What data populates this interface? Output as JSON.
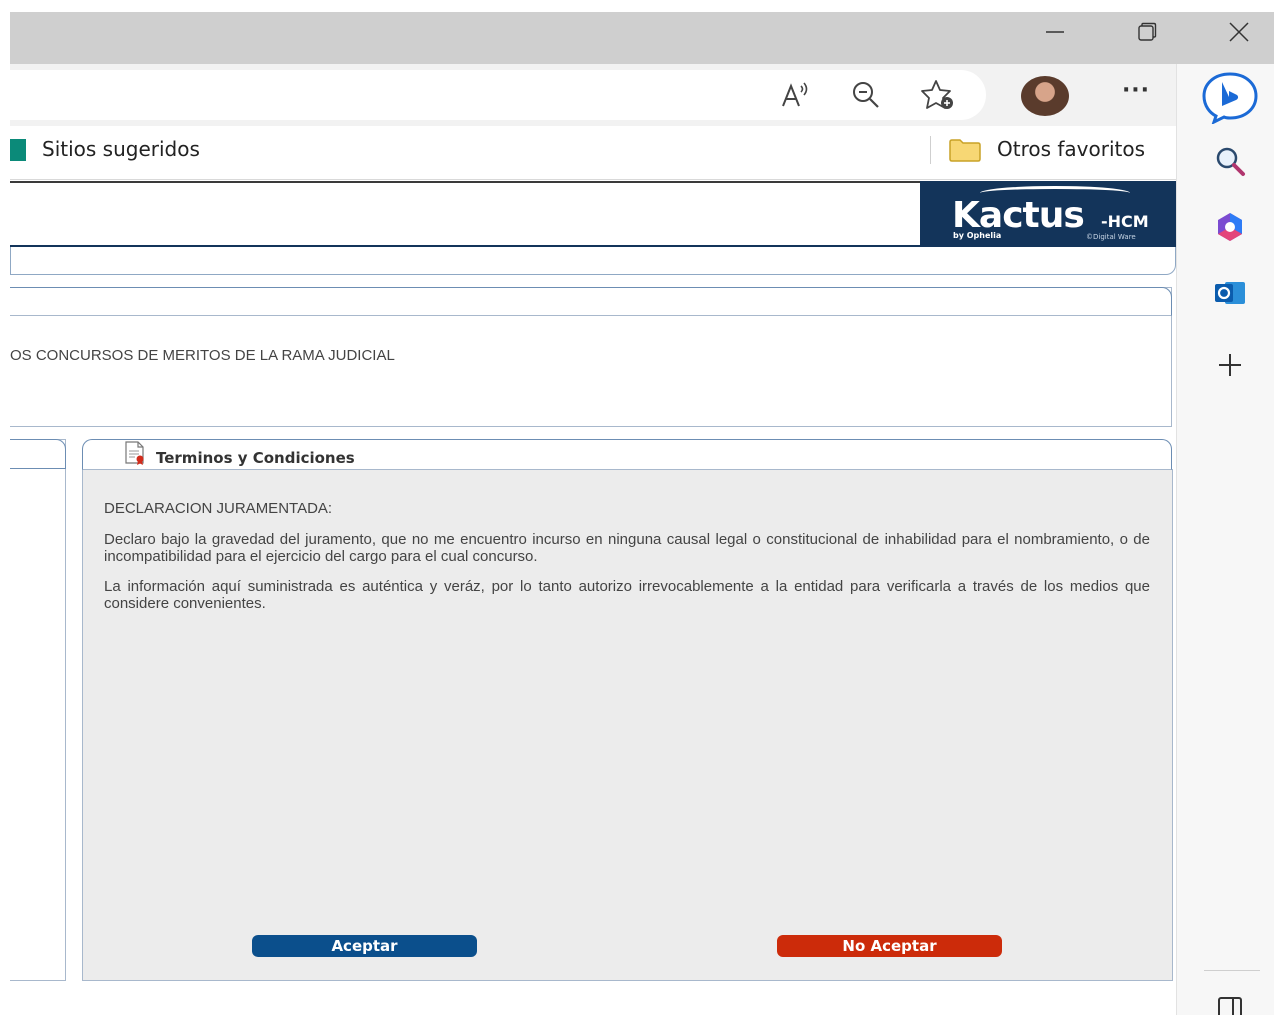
{
  "browser": {
    "window_controls": {
      "minimize_icon": "minimize-icon",
      "restore_icon": "restore-icon",
      "close_icon": "close-icon"
    },
    "toolbar_icons": [
      "read-aloud-icon",
      "zoom-out-icon",
      "add-favorite-icon",
      "profile-avatar",
      "more-icon"
    ],
    "more_label": "···",
    "favorites": {
      "suggested": "Sitios sugeridos",
      "other": "Otros favoritos"
    },
    "sidebar_icons": [
      "bing-chat-icon",
      "search-icon",
      "office-icon",
      "outlook-icon",
      "add-icon",
      "split-screen-icon"
    ]
  },
  "site": {
    "logo": {
      "main": "Kactus",
      "suffix": "-HCM",
      "sub": "by Ophelia",
      "copyright": "©Digital Ware"
    },
    "section_text": "OS CONCURSOS DE MERITOS DE LA RAMA JUDICIAL",
    "tab_title": "Terminos y Condiciones",
    "declaration_title": "DECLARACION JURAMENTADA:",
    "paragraphs": [
      "Declaro bajo la gravedad del juramento, que no me encuentro incurso en ninguna causal legal o constitucional de inhabilidad para el nombramiento, o de incompatibilidad para el ejercicio del cargo para el cual concurso.",
      "La información aquí suministrada es auténtica y veráz, por lo tanto autorizo irrevocablemente a la entidad para verificarla a través de los medios que considere convenientes."
    ],
    "buttons": {
      "accept": "Aceptar",
      "reject": "No Aceptar"
    }
  },
  "colors": {
    "accept": "#0b4f8c",
    "reject": "#cc2b0a",
    "header_navy": "#13345a",
    "panel_bg": "#ececec"
  }
}
